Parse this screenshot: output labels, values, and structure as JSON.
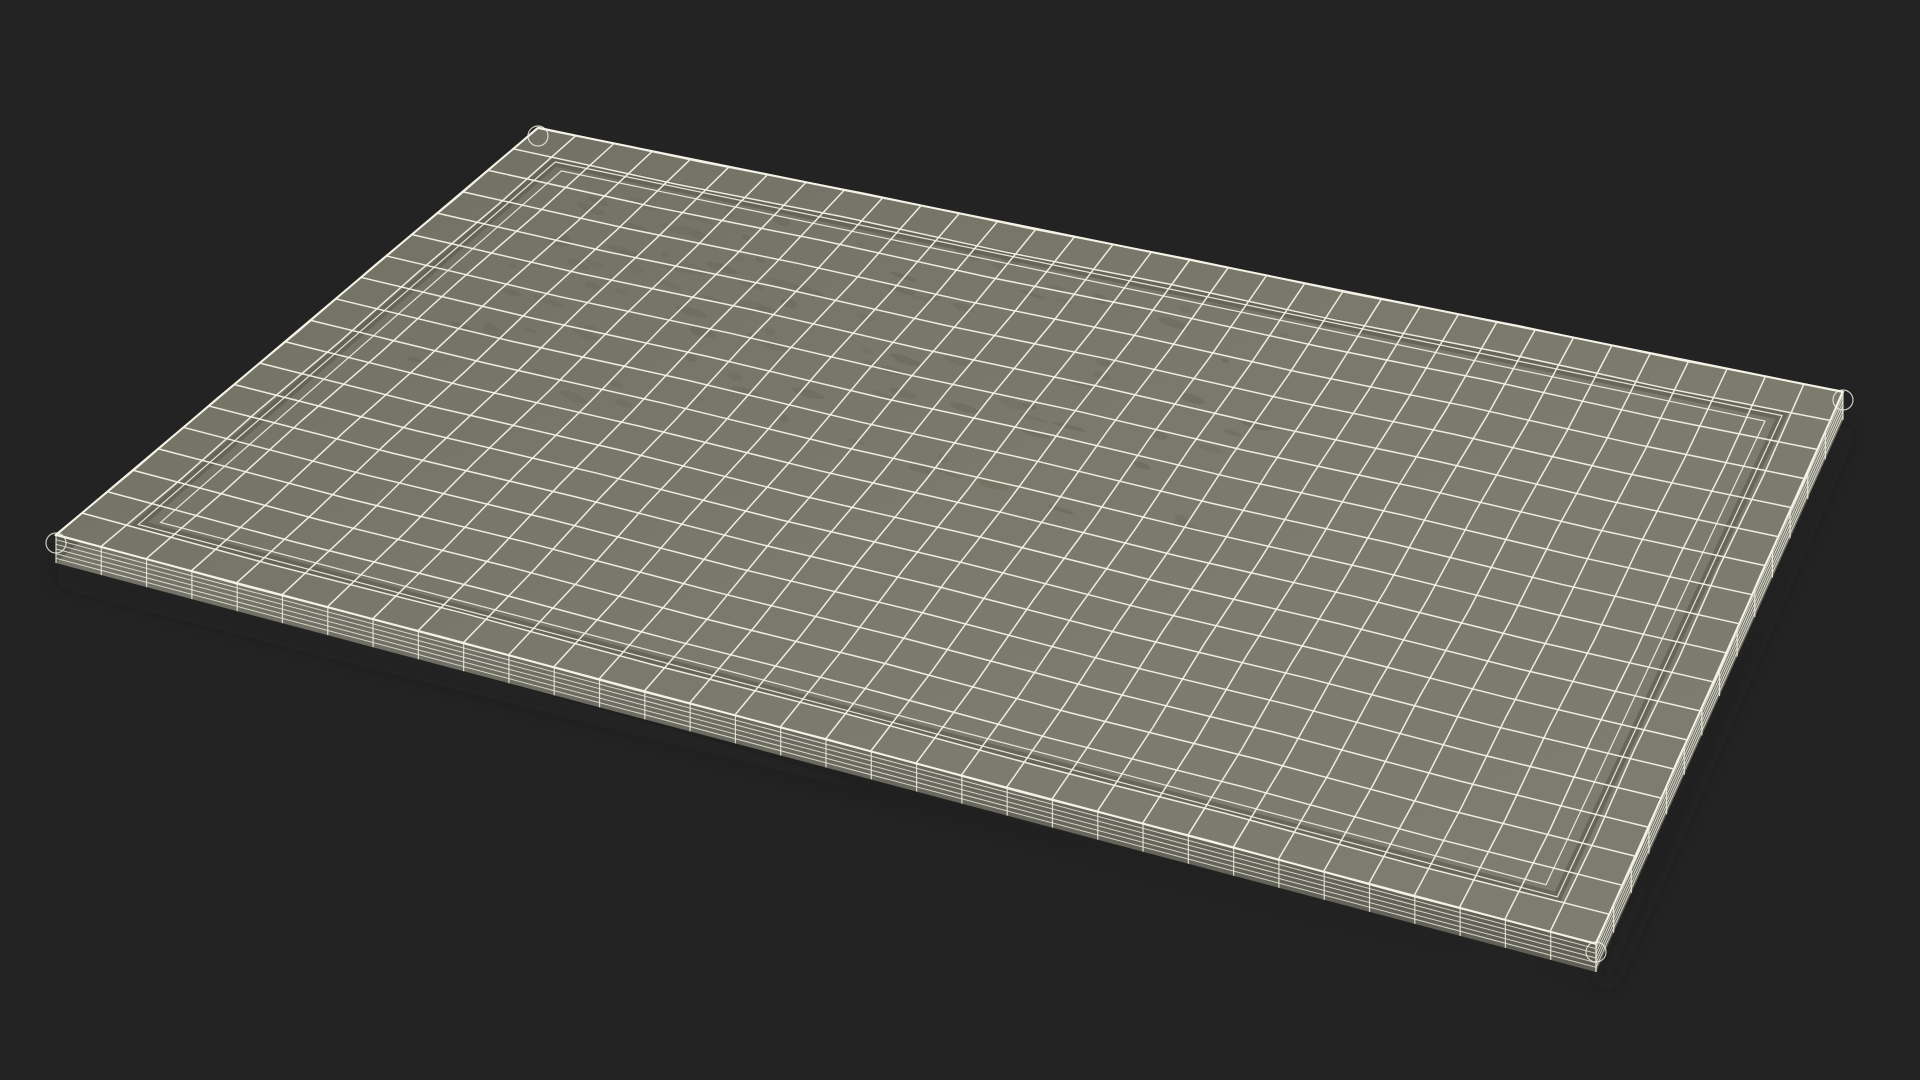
{
  "scene": {
    "subject": "cutting-board-wireframe",
    "background_color": "#232323",
    "board_face_color": "#7a7a6c",
    "board_face_dark_color": "#6b6b5e",
    "board_side_color": "#6e6e62",
    "groove_color": "#5f5f54",
    "wire_color": "#f4f2e6",
    "wire_side_color": "#e9e7da",
    "shadow_color": "#1b1b1b"
  }
}
